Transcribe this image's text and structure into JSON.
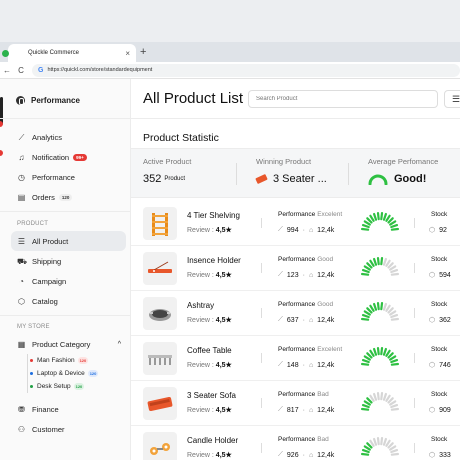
{
  "browser": {
    "tab_title": "Quickle Commerce",
    "tab_close": "×",
    "new_tab": "+",
    "back": "←",
    "reload": "C",
    "url": "https://quickl.com/store/standardequipment"
  },
  "sidebar": {
    "brand": "Performance",
    "menu": [
      {
        "label": "Analytics",
        "icon": "chart-icon",
        "glyph": "⟋"
      },
      {
        "label": "Notification",
        "icon": "bell-icon",
        "glyph": "♫",
        "badge": "99+"
      },
      {
        "label": "Performance",
        "icon": "clock-icon",
        "glyph": "◷"
      },
      {
        "label": "Orders",
        "icon": "orders-icon",
        "glyph": "▤",
        "badge": "120"
      }
    ],
    "product_section": "PRODUCT",
    "product_items": [
      {
        "label": "All Product",
        "icon": "list-icon",
        "glyph": "☰"
      },
      {
        "label": "Shipping",
        "icon": "truck-icon",
        "glyph": "⛟"
      },
      {
        "label": "Campaign",
        "icon": "campaign-icon",
        "glyph": "◔"
      },
      {
        "label": "Catalog",
        "icon": "catalog-icon",
        "glyph": "⬡"
      }
    ],
    "store_section": "MY STORE",
    "category": {
      "label": "Product Category",
      "icon": "category-icon",
      "chevron": "^"
    },
    "sub_items": [
      {
        "label": "Man Fashion",
        "badge": "120",
        "color": "#e53935",
        "badge_bg": "#fde3e2"
      },
      {
        "label": "Laptop & Device",
        "badge": "120",
        "color": "#1e6fe0",
        "badge_bg": "#dfe9fb"
      },
      {
        "label": "Desk Setup",
        "badge": "120",
        "color": "#22a045",
        "badge_bg": "#dcf2e2"
      }
    ],
    "finance": {
      "label": "Finance",
      "glyph": "⛃"
    },
    "customer": {
      "label": "Customer",
      "glyph": "⚇"
    }
  },
  "main": {
    "title": "All Product List",
    "search_placeholder": "Search Product",
    "filter_glyph": "☰"
  },
  "stats": {
    "title": "Product Statistic",
    "active_label": "Active Product",
    "active_value": "352",
    "active_unit": "Product",
    "winning_label": "Winning Product",
    "winning_value": "3 Seater ...",
    "avg_label": "Average Perfomance",
    "avg_value": "Good!"
  },
  "products": [
    {
      "name": "4 Tier Shelving",
      "review_label": "Review",
      "review": "4,5★",
      "perf_label": "Performance",
      "perf": "Excelent",
      "level": 1.0,
      "sales": "994",
      "views": "12,4k",
      "stock_label": "Stock",
      "stock": "92",
      "thumb": "shelf"
    },
    {
      "name": "Insence Holder",
      "review_label": "Review",
      "review": "4,5★",
      "perf_label": "Performance",
      "perf": "Good",
      "level": 0.55,
      "sales": "123",
      "views": "12,4k",
      "stock_label": "Stock",
      "stock": "594",
      "thumb": "incense"
    },
    {
      "name": "Ashtray",
      "review_label": "Review",
      "review": "4,5★",
      "perf_label": "Performance",
      "perf": "Good",
      "level": 0.55,
      "sales": "637",
      "views": "12,4k",
      "stock_label": "Stock",
      "stock": "362",
      "thumb": "ashtray"
    },
    {
      "name": "Coffee Table",
      "review_label": "Review",
      "review": "4,5★",
      "perf_label": "Performance",
      "perf": "Excelent",
      "level": 1.0,
      "sales": "148",
      "views": "12,4k",
      "stock_label": "Stock",
      "stock": "746",
      "thumb": "table"
    },
    {
      "name": "3 Seater Sofa",
      "review_label": "Review",
      "review": "4,5★",
      "perf_label": "Performance",
      "perf": "Bad",
      "level": 0.25,
      "sales": "817",
      "views": "12,4k",
      "stock_label": "Stock",
      "stock": "909",
      "thumb": "sofa"
    },
    {
      "name": "Candle Holder",
      "review_label": "Review",
      "review": "4,5★",
      "perf_label": "Performance",
      "perf": "Bad",
      "level": 0.25,
      "sales": "926",
      "views": "12,4k",
      "stock_label": "Stock",
      "stock": "333",
      "thumb": "candle"
    }
  ],
  "colors": {
    "gauge_on": "#2ec042",
    "gauge_off": "#d6d6d6",
    "accent_red": "#e53935"
  }
}
